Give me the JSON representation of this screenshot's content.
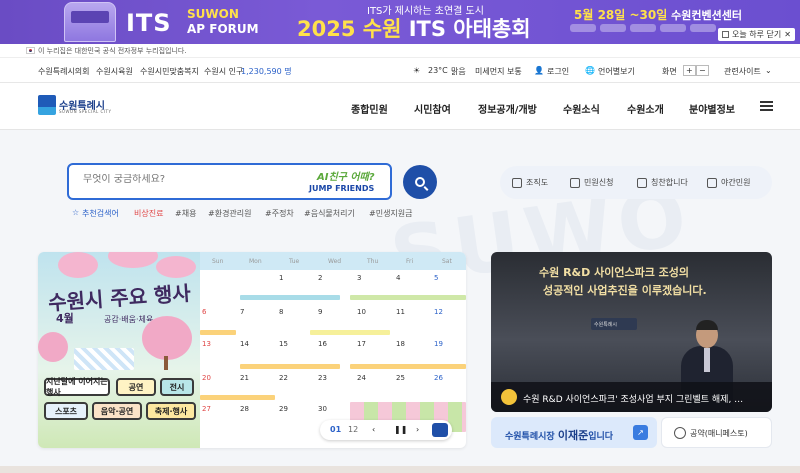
{
  "banner": {
    "its": "ITS",
    "suwon_line1": "SUWON",
    "suwon_line2": "AP FORUM",
    "tagline": "ITS가 제시하는 초연결 도시",
    "title_year": "2025",
    "title_city": "수원",
    "title_rest": "ITS 아태총회",
    "date_text": "5월 28일 ~30일",
    "venue": "수원컨벤션센터",
    "close_label": "오늘 하루 닫기"
  },
  "gov_notice": "이 누리집은 대한민국 공식 전자정부 누리집입니다.",
  "util": {
    "links": [
      "수원특례시의회",
      "수원시육원",
      "수원시민맞춤복지"
    ],
    "population_label": "수원시 인구",
    "population_value": "1,230,590 명",
    "weather_temp": "23°C",
    "weather_state": "맑음",
    "dust": "미세먼지 보통",
    "login": "로그인",
    "language": "언어별보기",
    "zoom_label": "화면",
    "zoom_plus": "+",
    "zoom_minus": "−",
    "related": "관련사이트"
  },
  "nav": {
    "logo_text": "수원특례시",
    "logo_sub": "SUWON SPECIAL CITY",
    "menu": [
      "종합민원",
      "시민참여",
      "정보공개/개방",
      "수원소식",
      "수원소개",
      "분야별정보"
    ]
  },
  "search": {
    "placeholder": "무엇이 궁금하세요?",
    "jump_line1": "AI친구 어때?",
    "jump_line2": "JUMP FRIENDS"
  },
  "tags": {
    "recommend": "추천검색어",
    "items": [
      "비상진료",
      "#채용",
      "#환경관리원",
      "#주정차",
      "#음식물처리기",
      "#민생지원금"
    ]
  },
  "quick": [
    "조직도",
    "민원신청",
    "칭찬합니다",
    "야간민원"
  ],
  "calendar": {
    "title": "수원시 주요 행사",
    "month": "4월",
    "subtitle": "공감·배움·체육",
    "days": [
      "Sun",
      "Mon",
      "Tue",
      "Wed",
      "Thu",
      "Fri",
      "Sat"
    ],
    "dates": [
      [
        "",
        "",
        "1",
        "2",
        "3",
        "4",
        "5"
      ],
      [
        "6",
        "7",
        "8",
        "9",
        "10",
        "11",
        "12"
      ],
      [
        "13",
        "14",
        "15",
        "16",
        "17",
        "18",
        "19"
      ],
      [
        "20",
        "21",
        "22",
        "23",
        "24",
        "25",
        "26"
      ],
      [
        "27",
        "28",
        "29",
        "30",
        "",
        "",
        ""
      ]
    ],
    "legend": [
      "지난달에 이어지는 행사",
      "공연",
      "전시",
      "스포츠",
      "음악·공연",
      "축제·행사"
    ],
    "page_current": "01",
    "page_total": "12",
    "pause": "❚❚"
  },
  "news": {
    "headline_line1": "수원 R&D 사이언스파크 조성의",
    "headline_line2": "성공적인 사업추진을 이루겠습니다.",
    "caption": "수원 R&D 사이언스파크' 조성사업 부지 그린벨트 해제, …",
    "badge": "수원특례시"
  },
  "mayor": {
    "prefix": "수원특례시장",
    "name": "이재준",
    "suffix": "입니다",
    "arrow": "↗"
  },
  "pledge": "공약(매니페스토)",
  "bg_word": "SUWO"
}
